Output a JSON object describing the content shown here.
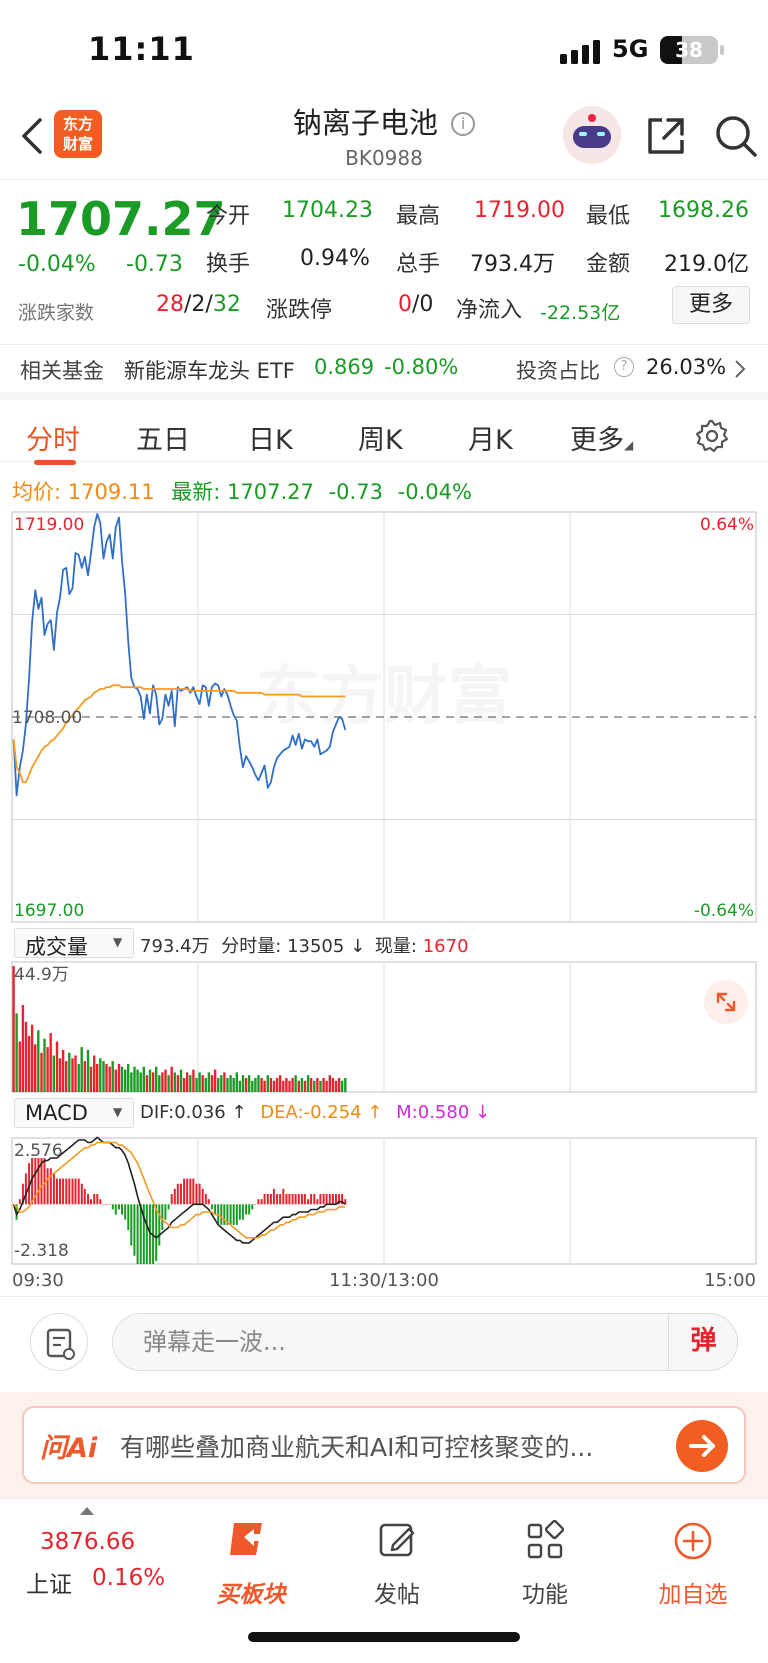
{
  "status_bar": {
    "time": "11:11",
    "network": "5G",
    "battery": "38"
  },
  "header": {
    "title": "钠离子电池",
    "code": "BK0988",
    "logo_line1": "东方",
    "logo_line2": "财富"
  },
  "quote": {
    "price": "1707.27",
    "change_pct": "-0.04%",
    "change": "-0.73",
    "open_label": "今开",
    "open": "1704.23",
    "high_label": "最高",
    "high": "1719.00",
    "low_label": "最低",
    "low": "1698.26",
    "turnover_label": "换手",
    "turnover": "0.94%",
    "volume_label": "总手",
    "volume": "793.4万",
    "amount_label": "金额",
    "amount": "219.0亿",
    "breadth_label": "涨跌家数",
    "breadth_up": "28",
    "breadth_flat": "2",
    "breadth_down": "32",
    "slash": "/",
    "limit_label": "涨跌停",
    "limit_up": "0",
    "limit_down": "0",
    "inflow_label": "净流入",
    "inflow": "-22.53亿",
    "more_label": "更多"
  },
  "fund": {
    "label": "相关基金",
    "name": "新能源车龙头 ETF",
    "price": "0.869",
    "change": "-0.80%",
    "ratio_label": "投资占比",
    "ratio": "26.03%"
  },
  "tabs": [
    {
      "label": "分时",
      "active": true
    },
    {
      "label": "五日"
    },
    {
      "label": "日K"
    },
    {
      "label": "周K"
    },
    {
      "label": "月K"
    },
    {
      "label": "更多"
    }
  ],
  "chart_info": {
    "avg_label": "均价:",
    "avg": "1709.11",
    "latest_label": "最新:",
    "latest": "1707.27",
    "latest_change": "-0.73",
    "latest_pct": "-0.04%"
  },
  "chart_data": [
    {
      "type": "line",
      "title": "",
      "y_labels_left": [
        "1719.00",
        "1708.00",
        "1697.00"
      ],
      "y_labels_right": [
        "0.64%",
        "-0.64%"
      ],
      "x_labels": [
        "09:30",
        "11:30/13:00",
        "15:00"
      ],
      "ylim": [
        1697.0,
        1719.0
      ],
      "prev_close": 1708.0,
      "watermark": "东方财富",
      "series": [
        {
          "key": "price",
          "color": "#2f6fc8",
          "values": [
            1706.8,
            1703.8,
            1705.3,
            1706.2,
            1707.6,
            1710.1,
            1713.1,
            1714.8,
            1713.8,
            1714.4,
            1712.4,
            1713.0,
            1713.2,
            1711.6,
            1713.6,
            1714.4,
            1715.9,
            1716.0,
            1714.6,
            1714.9,
            1716.8,
            1716.7,
            1716.0,
            1716.6,
            1715.6,
            1716.8,
            1718.2,
            1718.9,
            1718.4,
            1716.5,
            1717.4,
            1717.8,
            1716.5,
            1718.2,
            1718.7,
            1716.4,
            1714.6,
            1712.0,
            1710.1,
            1709.6,
            1709.5,
            1709.1,
            1707.9,
            1709.2,
            1708.2,
            1709.7,
            1709.2,
            1707.6,
            1707.9,
            1709.2,
            1708.6,
            1709.4,
            1707.5,
            1709.6,
            1709.4,
            1709.5,
            1709.6,
            1709.3,
            1709.6,
            1709.1,
            1708.7,
            1709.7,
            1709.6,
            1708.6,
            1709.6,
            1709.8,
            1709.7,
            1709.1,
            1709.5,
            1709.2,
            1708.6,
            1708.1,
            1707.8,
            1706.4,
            1705.3,
            1705.9,
            1705.6,
            1705.3,
            1704.9,
            1704.6,
            1705.0,
            1705.4,
            1704.2,
            1704.5,
            1705.3,
            1705.8,
            1706.0,
            1706.2,
            1706.3,
            1706.4,
            1707.0,
            1706.5,
            1707.1,
            1706.3,
            1706.8,
            1706.7,
            1706.7,
            1706.4,
            1706.8,
            1706.0,
            1706.1,
            1706.2,
            1706.4,
            1707.2,
            1707.6,
            1708.0,
            1707.9,
            1707.3
          ]
        },
        {
          "key": "avg",
          "color": "#f59a23",
          "values": [
            1706.8,
            1705.3,
            1705.0,
            1704.5,
            1704.5,
            1704.9,
            1705.3,
            1705.6,
            1705.9,
            1706.2,
            1706.4,
            1706.5,
            1706.7,
            1706.8,
            1707.0,
            1707.2,
            1707.4,
            1707.7,
            1707.9,
            1708.1,
            1708.3,
            1708.5,
            1708.7,
            1708.9,
            1709.0,
            1709.1,
            1709.3,
            1709.4,
            1709.5,
            1709.5,
            1709.6,
            1709.6,
            1709.7,
            1709.7,
            1709.7,
            1709.6,
            1709.6,
            1709.6,
            1709.6,
            1709.6,
            1709.6,
            1709.6,
            1709.5,
            1709.5,
            1709.5,
            1709.5,
            1709.5,
            1709.5,
            1709.5,
            1709.5,
            1709.5,
            1709.5,
            1709.5,
            1709.5,
            1709.5,
            1709.5,
            1709.5,
            1709.4,
            1709.4,
            1709.4,
            1709.4,
            1709.4,
            1709.4,
            1709.4,
            1709.4,
            1709.4,
            1709.4,
            1709.4,
            1709.4,
            1709.4,
            1709.4,
            1709.4,
            1709.3,
            1709.3,
            1709.3,
            1709.3,
            1709.3,
            1709.3,
            1709.3,
            1709.3,
            1709.3,
            1709.2,
            1709.2,
            1709.2,
            1709.2,
            1709.2,
            1709.2,
            1709.2,
            1709.2,
            1709.2,
            1709.2,
            1709.2,
            1709.2,
            1709.1,
            1709.1,
            1709.1,
            1709.1,
            1709.1,
            1709.1,
            1709.1,
            1709.1,
            1709.1,
            1709.1,
            1709.1,
            1709.1,
            1709.1,
            1709.1,
            1709.1
          ]
        }
      ]
    },
    {
      "type": "bar",
      "title": "成交量",
      "y_label_top": "44.9万",
      "ylim": [
        0,
        44.9
      ],
      "values": [
        44.9,
        28,
        18,
        31,
        25,
        20,
        24,
        17,
        22,
        14,
        19,
        16,
        21,
        13,
        18,
        12,
        15,
        11,
        14,
        12,
        13,
        10,
        16,
        11,
        15,
        9,
        13,
        10,
        12,
        11,
        10,
        9,
        11,
        8,
        10,
        9,
        8,
        10,
        7,
        9,
        8,
        7,
        9,
        6,
        8,
        7,
        9,
        6,
        7,
        8,
        6,
        9,
        7,
        6,
        8,
        5,
        7,
        6,
        8,
        5,
        7,
        6,
        5,
        7,
        6,
        8,
        5,
        6,
        7,
        5,
        6,
        5,
        7,
        4,
        6,
        5,
        6,
        4,
        5,
        6,
        5,
        4,
        6,
        5,
        4,
        5,
        6,
        4,
        5,
        4,
        5,
        6,
        4,
        5,
        4,
        6,
        5,
        4,
        5,
        4,
        5,
        4,
        6,
        5,
        4,
        5,
        4,
        5
      ],
      "colors": [
        "r",
        "g"
      ]
    },
    {
      "type": "bar",
      "title": "MACD",
      "y_label_top": "2.576",
      "y_label_bottom": "-2.318",
      "ylim": [
        -2.318,
        2.576
      ],
      "dif": [
        0.0,
        -0.4,
        -0.2,
        0.1,
        0.4,
        0.7,
        1.0,
        1.2,
        1.4,
        1.6,
        1.7,
        1.7,
        1.8,
        1.8,
        1.8,
        1.9,
        2.0,
        2.1,
        2.2,
        2.3,
        2.4,
        2.5,
        2.5,
        2.5,
        2.4,
        2.4,
        2.5,
        2.6,
        2.5,
        2.4,
        2.4,
        2.4,
        2.3,
        2.2,
        2.2,
        2.1,
        1.9,
        1.6,
        1.2,
        0.8,
        0.3,
        -0.1,
        -0.5,
        -0.8,
        -1.1,
        -1.2,
        -1.3,
        -1.2,
        -1.1,
        -1.0,
        -0.9,
        -0.7,
        -0.6,
        -0.5,
        -0.4,
        -0.3,
        -0.2,
        -0.1,
        0.0,
        0.0,
        0.0,
        0.0,
        -0.1,
        -0.2,
        -0.4,
        -0.6,
        -0.8,
        -0.9,
        -1.0,
        -1.1,
        -1.2,
        -1.3,
        -1.4,
        -1.4,
        -1.5,
        -1.5,
        -1.5,
        -1.4,
        -1.3,
        -1.2,
        -1.1,
        -1.0,
        -0.9,
        -0.8,
        -0.7,
        -0.7,
        -0.6,
        -0.5,
        -0.5,
        -0.5,
        -0.4,
        -0.4,
        -0.3,
        -0.3,
        -0.3,
        -0.3,
        -0.2,
        -0.2,
        -0.2,
        -0.1,
        -0.1,
        0.0,
        0.0,
        0.0,
        0.0,
        0.1,
        0.1,
        0.0
      ],
      "dea": [
        0.0,
        -0.1,
        -0.3,
        -0.3,
        -0.2,
        -0.1,
        0.1,
        0.3,
        0.5,
        0.7,
        0.8,
        1.0,
        1.1,
        1.2,
        1.3,
        1.4,
        1.5,
        1.6,
        1.7,
        1.8,
        1.9,
        2.0,
        2.1,
        2.2,
        2.2,
        2.3,
        2.3,
        2.4,
        2.4,
        2.4,
        2.4,
        2.4,
        2.4,
        2.4,
        2.3,
        2.3,
        2.2,
        2.1,
        2.0,
        1.8,
        1.6,
        1.3,
        1.0,
        0.7,
        0.4,
        0.1,
        -0.2,
        -0.4,
        -0.6,
        -0.7,
        -0.8,
        -0.9,
        -0.9,
        -0.9,
        -0.8,
        -0.8,
        -0.7,
        -0.6,
        -0.5,
        -0.4,
        -0.4,
        -0.3,
        -0.3,
        -0.3,
        -0.3,
        -0.4,
        -0.4,
        -0.5,
        -0.6,
        -0.7,
        -0.8,
        -0.9,
        -1.0,
        -1.1,
        -1.2,
        -1.3,
        -1.3,
        -1.3,
        -1.3,
        -1.3,
        -1.2,
        -1.2,
        -1.1,
        -1.0,
        -1.0,
        -0.9,
        -0.8,
        -0.8,
        -0.7,
        -0.7,
        -0.6,
        -0.6,
        -0.5,
        -0.5,
        -0.5,
        -0.4,
        -0.4,
        -0.4,
        -0.3,
        -0.3,
        -0.3,
        -0.2,
        -0.2,
        -0.2,
        -0.2,
        -0.1,
        -0.1,
        -0.1
      ]
    }
  ],
  "volume_bar": {
    "label": "成交量",
    "total": "793.4万",
    "minute_label": "分时量:",
    "minute": "13505",
    "current_label": "现量:",
    "current": "1670"
  },
  "macd_bar": {
    "label": "MACD",
    "dif": "DIF:0.036",
    "dea": "DEA:-0.254",
    "m": "M:0.580"
  },
  "comment": {
    "placeholder": "弹幕走一波...",
    "danmu": "弹"
  },
  "ai": {
    "logo": "问Ai",
    "text": "有哪些叠加商业航天和AI和可控核聚变的..."
  },
  "bottom_nav": {
    "index_value": "3876.66",
    "index_name": "上证",
    "index_pct": "0.16%",
    "items": [
      {
        "label": "买板块"
      },
      {
        "label": "发帖"
      },
      {
        "label": "功能"
      },
      {
        "label": "加自选"
      }
    ]
  }
}
